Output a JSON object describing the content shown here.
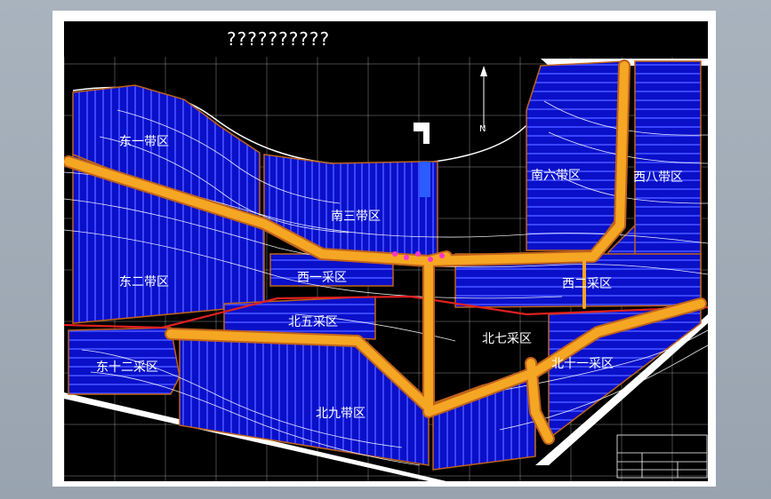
{
  "drawing": {
    "title": "??????????",
    "north_label": "N",
    "colors": {
      "background": "#000000",
      "panel": "#0a10c8",
      "panel_line": "#3a46ff",
      "road": "#f5a623",
      "road_edge": "#c0621a",
      "contour": "#ffffff",
      "boundary_red": "#e02020",
      "marker": "#ff33cc"
    },
    "zones": [
      {
        "id": "east-1",
        "label": "东一带区"
      },
      {
        "id": "south-3",
        "label": "南三带区"
      },
      {
        "id": "south-6",
        "label": "南六带区"
      },
      {
        "id": "west-8",
        "label": "西八带区"
      },
      {
        "id": "east-2",
        "label": "东二带区"
      },
      {
        "id": "west-4",
        "label": "西一采区"
      },
      {
        "id": "west-1",
        "label": "西二采区"
      },
      {
        "id": "north-5",
        "label": "北五采区"
      },
      {
        "id": "north-7",
        "label": "北七采区"
      },
      {
        "id": "east-12",
        "label": "东十二采区"
      },
      {
        "id": "north-10",
        "label": "北十一采区"
      },
      {
        "id": "north-9",
        "label": "北九带区"
      }
    ]
  }
}
